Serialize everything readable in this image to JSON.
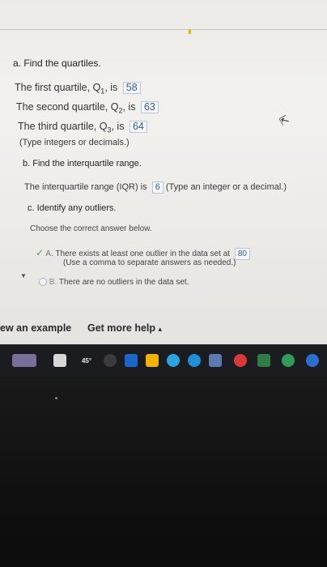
{
  "question": {
    "part_a_title": "a. Find the quartiles.",
    "q1_label": "The first quartile, Q",
    "q1_sub": "1",
    "q1_suffix": ", is",
    "q1_value": "58",
    "q2_label": "The second quartile, Q",
    "q2_sub": "2",
    "q2_suffix": ", is",
    "q2_value": "63",
    "q3_label": "The third quartile, Q",
    "q3_sub": "3",
    "q3_suffix": ", is",
    "q3_value": "64",
    "type_hint": "(Type integers or decimals.)",
    "part_b_title": "b. Find the interquartile range.",
    "iqr_label": "The interquartile range (IQR) is",
    "iqr_value": "6",
    "iqr_hint": "(Type an integer or a decimal.)",
    "part_c_title": "c. Identify any outliers.",
    "choose_text": "Choose the correct answer below.",
    "option_a_letter": "A.",
    "option_a_text": "There exists at least one outlier in the data set at",
    "option_a_value": "80",
    "option_a_hint": "(Use a comma to separate answers as needed.)",
    "option_b_letter": "B.",
    "option_b_text": "There are no outliers in the data set.",
    "check_mark": "✓"
  },
  "bottom_bar": {
    "view_example": "ew an example",
    "get_more_help": "Get more help",
    "help_caret": "▴"
  },
  "taskbar": {
    "weather_temp": "45°"
  },
  "colors": {
    "answer_text": "#2d5c95",
    "check_green": "#4a9a4a",
    "taskbar": "#1b1c20"
  }
}
